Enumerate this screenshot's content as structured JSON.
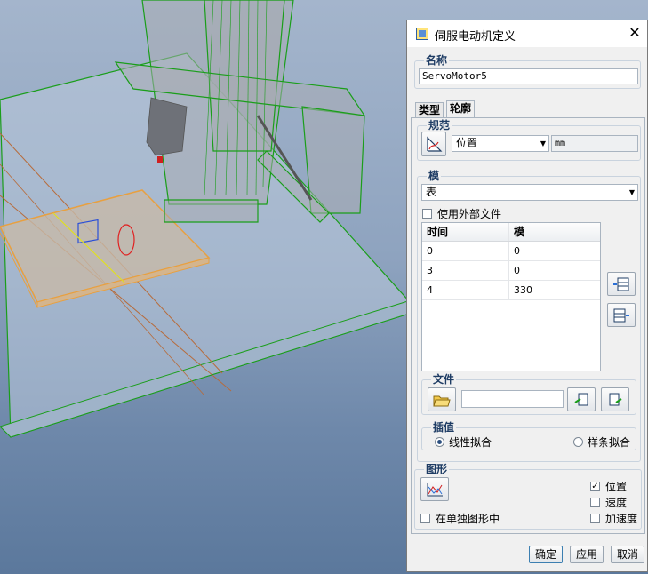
{
  "dialog": {
    "title": "伺服电动机定义",
    "close_symbol": "✕"
  },
  "name_group": {
    "label": "名称",
    "value": "ServoMotor5"
  },
  "tabs": [
    {
      "label": "类型",
      "active": false
    },
    {
      "label": "轮廓",
      "active": true
    }
  ],
  "spec_group": {
    "label": "规范",
    "icon": "spec-curve-icon",
    "select_value": "位置",
    "unit_value": "mm"
  },
  "module_group": {
    "label": "模",
    "select_value": "表",
    "use_external_label": "使用外部文件",
    "use_external_checked": false,
    "table": {
      "headers": [
        "时间",
        "模"
      ],
      "rows": [
        [
          "0",
          "0"
        ],
        [
          "3",
          "0"
        ],
        [
          "4",
          "330"
        ]
      ]
    },
    "insert_row_icon": "insert-row-icon",
    "append_row_icon": "append-row-icon"
  },
  "file_group": {
    "label": "文件",
    "open_icon": "folder-open-icon",
    "path_value": "",
    "load_icon": "load-file-icon",
    "save_icon": "save-file-icon"
  },
  "interp_group": {
    "label": "插值",
    "linear_label": "线性拟合",
    "linear_selected": true,
    "spline_label": "样条拟合",
    "spline_selected": false
  },
  "graph_group": {
    "label": "图形",
    "graph_icon": "graph-icon",
    "separate_label": "在单独图形中",
    "separate_checked": false,
    "position_label": "位置",
    "position_checked": true,
    "velocity_label": "速度",
    "velocity_checked": false,
    "accel_label": "加速度",
    "accel_checked": false
  },
  "footer": {
    "ok_label": "确定",
    "apply_label": "应用",
    "cancel_label": "取消"
  },
  "colors": {
    "accent_label": "#1e3c64",
    "model_green": "#1a9e1a",
    "plate_orange": "#e8a040"
  }
}
